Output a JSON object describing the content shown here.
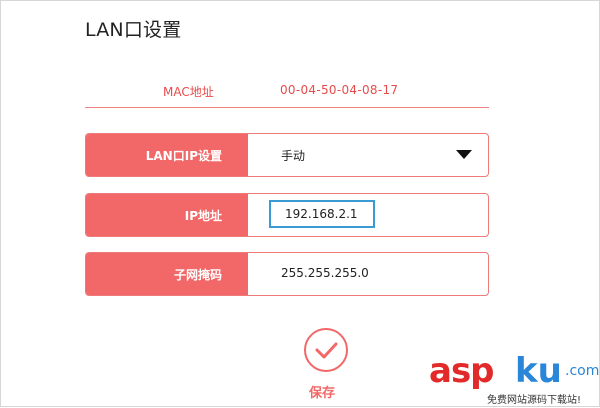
{
  "page": {
    "title": "LAN口设置"
  },
  "mac": {
    "label": "MAC地址",
    "value": "00-04-50-04-08-17"
  },
  "fields": {
    "lan_ip_mode": {
      "label": "LAN口IP设置",
      "value": "手动"
    },
    "ip_address": {
      "label": "IP地址",
      "value": "192.168.2.1"
    },
    "subnet_mask": {
      "label": "子网掩码",
      "value": "255.255.255.0"
    }
  },
  "actions": {
    "save_label": "保存",
    "save_icon": "checkmark-icon"
  },
  "watermark": {
    "brand_a": "asp",
    "brand_b": "ku",
    "brand_suffix": ".com",
    "tagline": "免费网站源码下载站!"
  },
  "colors": {
    "accent": "#f26868",
    "mac_text": "#e94b4b",
    "input_focus": "#3a9ad4"
  }
}
